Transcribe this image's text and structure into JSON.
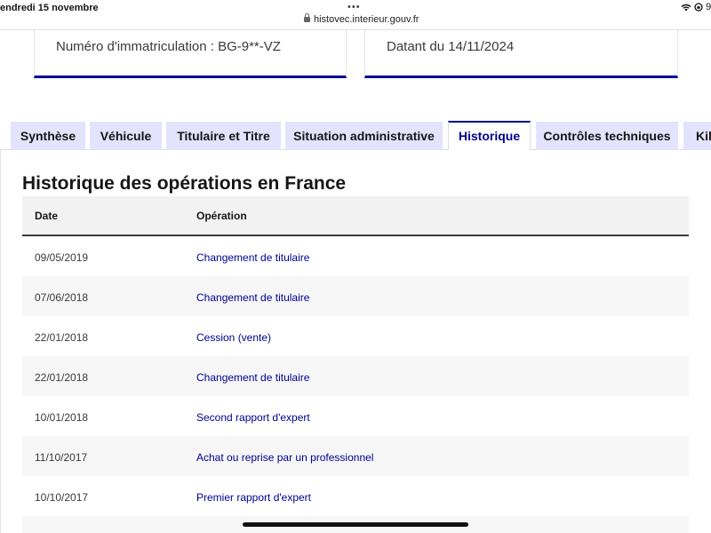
{
  "status_bar": {
    "time": "endredi 15 novembre",
    "dots": "•••",
    "url": "histovec.interieur.gouv.fr",
    "battery": "9"
  },
  "cards": {
    "registration": "Numéro d'immatriculation : BG-9**-VZ",
    "date": "Datant du 14/11/2024"
  },
  "tabs": [
    {
      "label": "Synthèse",
      "active": false
    },
    {
      "label": "Véhicule",
      "active": false
    },
    {
      "label": "Titulaire et Titre",
      "active": false
    },
    {
      "label": "Situation administrative",
      "active": false
    },
    {
      "label": "Historique",
      "active": true
    },
    {
      "label": "Contrôles techniques",
      "active": false
    },
    {
      "label": "Kilométrage",
      "active": false
    }
  ],
  "section": {
    "title": "Historique des opérations en France"
  },
  "table": {
    "headers": {
      "date": "Date",
      "operation": "Opération"
    },
    "rows": [
      {
        "date": "09/05/2019",
        "operation": "Changement de titulaire"
      },
      {
        "date": "07/06/2018",
        "operation": "Changement de titulaire"
      },
      {
        "date": "22/01/2018",
        "operation": "Cession (vente)"
      },
      {
        "date": "22/01/2018",
        "operation": "Changement de titulaire"
      },
      {
        "date": "10/01/2018",
        "operation": "Second rapport d'expert"
      },
      {
        "date": "11/10/2017",
        "operation": "Achat ou reprise par un professionnel"
      },
      {
        "date": "10/10/2017",
        "operation": "Premier rapport d'expert"
      },
      {
        "date": "",
        "operation": ""
      }
    ]
  },
  "colors": {
    "accent": "#000091",
    "tab_background": "#e3e3fd",
    "row_stripe": "#f6f6f6",
    "header_background": "#f2f2f2"
  }
}
